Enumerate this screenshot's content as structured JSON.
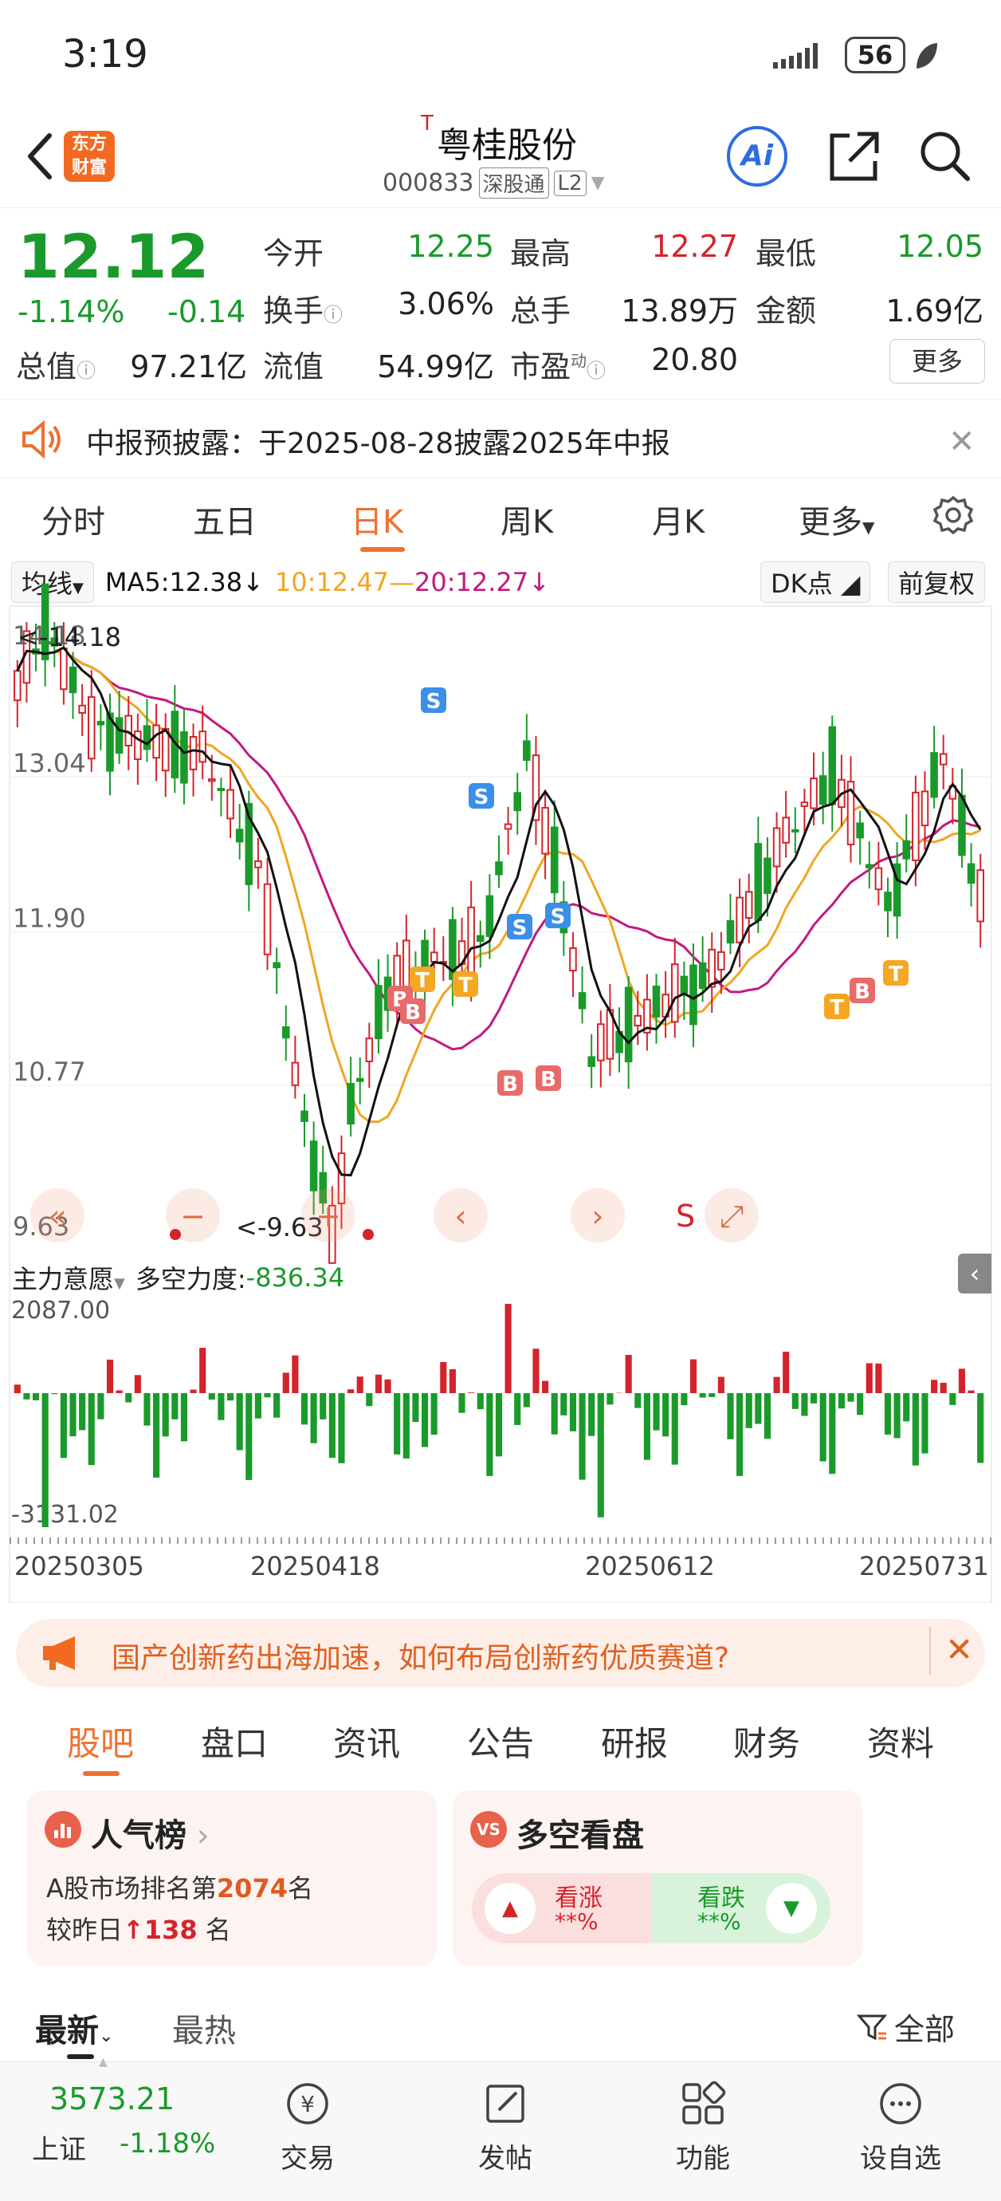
{
  "status_bar": {
    "time": "3:19",
    "battery": "56"
  },
  "header": {
    "stock_name": "粤桂股份",
    "name_prefix": "T",
    "stock_code": "000833",
    "exchange_tag": "深股通",
    "level_tag": "L2",
    "app_logo_text": "东方财富",
    "ai_label": "Ai"
  },
  "quote": {
    "price": "12.12",
    "change_pct": "-1.14%",
    "change_abs": "-0.14",
    "fields": [
      {
        "label": "今开",
        "value": "12.25",
        "color": "green"
      },
      {
        "label": "最高",
        "value": "12.27",
        "color": "red"
      },
      {
        "label": "最低",
        "value": "12.05",
        "color": "green"
      },
      {
        "label": "换手",
        "value": "3.06%",
        "color": "black"
      },
      {
        "label": "总手",
        "value": "13.89万",
        "color": "black"
      },
      {
        "label": "金额",
        "value": "1.69亿",
        "color": "black"
      },
      {
        "label": "总值",
        "value": "97.21亿",
        "color": "black"
      },
      {
        "label": "流值",
        "value": "54.99亿",
        "color": "black"
      },
      {
        "label": "市盈",
        "value": "20.80",
        "color": "black"
      }
    ],
    "pe_sup": "动",
    "more_label": "更多"
  },
  "notice": {
    "text": "中报预披露：于2025-08-28披露2025年中报"
  },
  "period_tabs": [
    {
      "label": "分时",
      "active": false
    },
    {
      "label": "五日",
      "active": false
    },
    {
      "label": "日K",
      "active": true
    },
    {
      "label": "周K",
      "active": false
    },
    {
      "label": "月K",
      "active": false
    },
    {
      "label": "更多",
      "active": false
    }
  ],
  "ma_bar": {
    "selector": "均线",
    "ma5": "MA5:12.38",
    "ma10": "10:12.47",
    "ma20": "20:12.27",
    "dk_label": "DK点",
    "adjust_label": "前复权"
  },
  "chart_data": [
    {
      "type": "candlestick",
      "y_ticks": [
        "14.18",
        "13.04",
        "11.90",
        "10.77",
        "9.63"
      ],
      "ylim": [
        9.63,
        14.18
      ],
      "max_label": "<-14.18",
      "min_label": "<-9.63",
      "x_ticks": [
        "20250305",
        "20250418",
        "20250612",
        "20250731"
      ],
      "markers": [
        "S",
        "S",
        "S",
        "S",
        "B",
        "B",
        "T",
        "T",
        "B",
        "B",
        "T",
        "B",
        "T"
      ],
      "controls": [
        "«",
        "−",
        "+",
        "‹",
        "›",
        "S",
        "⤢"
      ],
      "colors": {
        "up": "#d4242b",
        "down": "#1a9a2a",
        "ma5": "#111111",
        "ma10": "#f0a623",
        "ma20": "#c21a7e"
      }
    },
    {
      "type": "bar",
      "indicator": "主力意愿",
      "label": "多空力度:",
      "value": "-836.34",
      "y_ticks": [
        "2087.00",
        "-3131.02"
      ],
      "ylim": [
        -3131.02,
        2087.0
      ]
    }
  ],
  "banner": {
    "text": "国产创新药出海加速，如何布局创新药优质赛道?"
  },
  "section_tabs": [
    "股吧",
    "盘口",
    "资讯",
    "公告",
    "研报",
    "财务",
    "资料"
  ],
  "popularity": {
    "title": "人气榜",
    "rank_prefix": "A股市场排名第",
    "rank": "2074",
    "rank_suffix": "名",
    "change_prefix": "较昨日",
    "change": "138",
    "change_suffix": "名"
  },
  "sentiment": {
    "title": "多空看盘",
    "up_label": "看涨",
    "up_value": "**%",
    "down_label": "看跌",
    "down_value": "**%"
  },
  "feed_tabs": {
    "latest": "最新",
    "hot": "最热",
    "filter": "全部"
  },
  "bottom_nav": {
    "index_value": "3573.21",
    "index_name": "上证",
    "index_change": "-1.18%",
    "items": [
      "交易",
      "发帖",
      "功能",
      "设自选"
    ]
  }
}
